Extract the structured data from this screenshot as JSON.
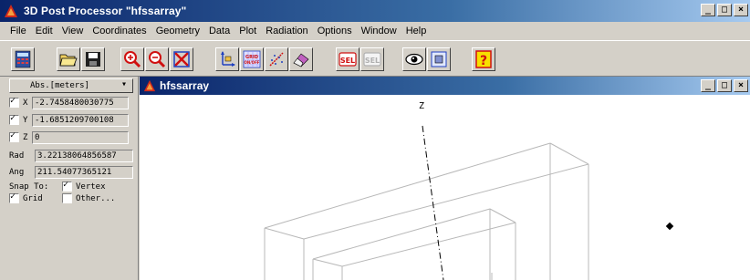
{
  "window": {
    "title": "3D Post Processor \"hfssarray\"",
    "min_label": "_",
    "max_label": "□",
    "close_label": "×"
  },
  "menu": [
    "File",
    "Edit",
    "View",
    "Coordinates",
    "Geometry",
    "Data",
    "Plot",
    "Radiation",
    "Options",
    "Window",
    "Help"
  ],
  "toolbar": {
    "icons": [
      "calculator-icon",
      "open-folder-icon",
      "save-icon",
      "zoom-in-icon",
      "zoom-out-icon",
      "zoom-fit-icon",
      "axes-icon",
      "grid-toggle-icon",
      "scatter-icon",
      "eraser-icon",
      "select-icon",
      "deselect-icon",
      "view-eye-icon",
      "view-box-icon",
      "help-icon"
    ],
    "grid_text_top": "GRID",
    "grid_text_bottom": "ON/OFF",
    "sel_text": "SEL",
    "help_text": "?"
  },
  "panel": {
    "units": "Abs.[meters]",
    "x_label": "X",
    "x_value": "-2.7458480030775",
    "y_label": "Y",
    "y_value": "-1.6851209700108",
    "z_label": "Z",
    "z_value": "0",
    "rad_label": "Rad",
    "rad_value": "3.22138064856587",
    "ang_label": "Ang",
    "ang_value": "211.54077365121",
    "snap_label": "Snap To:",
    "vertex_label": "Vertex",
    "grid_label": "Grid",
    "other_label": "Other..."
  },
  "child": {
    "title": "hfssarray",
    "axis_z": "Z"
  },
  "colors": {
    "titlebar_start": "#0a246a",
    "titlebar_end": "#a6caf0",
    "face": "#d4d0c8"
  }
}
